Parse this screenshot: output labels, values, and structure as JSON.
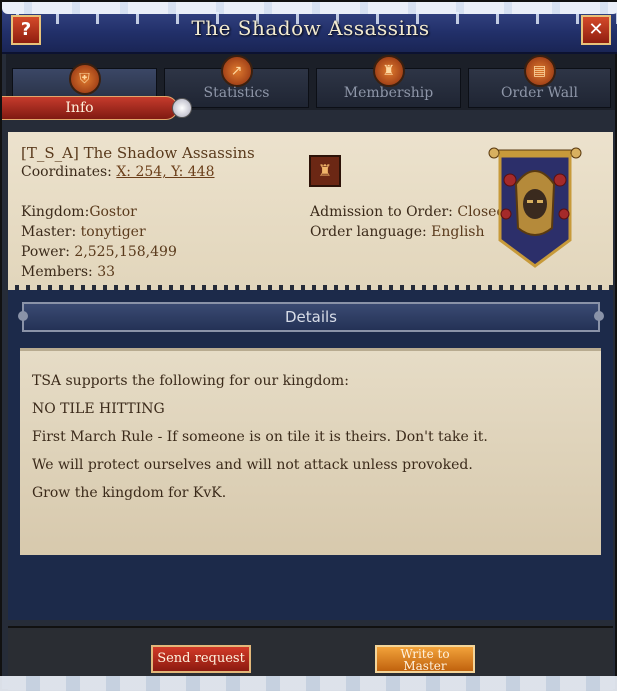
{
  "window": {
    "title": "The Shadow Assassins",
    "help_label": "?",
    "close_label": "✕"
  },
  "tabs": [
    {
      "label": "Info",
      "icon": "shield-crest-icon"
    },
    {
      "label": "Statistics",
      "icon": "chart-icon"
    },
    {
      "label": "Membership",
      "icon": "helmet-icon"
    },
    {
      "label": "Order Wall",
      "icon": "scroll-icon"
    }
  ],
  "order": {
    "name": "[T_S_A] The Shadow Assassins",
    "coordinates_label": "Coordinates:",
    "coordinates_value": "X: 254, Y: 448",
    "kingdom_label": "Kingdom:",
    "kingdom_value": "Gostor",
    "master_label": "Master:",
    "master_value": "tonytiger",
    "power_label": "Power:",
    "power_value": "2,525,158,499",
    "members_label": "Members:",
    "members_value": "33",
    "admission_label": "Admission to Order:",
    "admission_value": "Closed",
    "language_label": "Order language:",
    "language_value": "English",
    "crest_icon": "castle-tower-icon",
    "banner_icon": "hooded-assassin-banner-icon"
  },
  "details": {
    "header": "Details",
    "lines": [
      "TSA supports the following for our kingdom:",
      "NO TILE HITTING",
      "First March Rule - If someone is on tile it is theirs.  Don't take it.",
      "We will protect ourselves and will not attack unless provoked.",
      "Grow the kingdom for KvK."
    ]
  },
  "buttons": {
    "send_request": "Send request",
    "write_to_master_line1": "Write to",
    "write_to_master_line2": "Master"
  },
  "colors": {
    "title_bar": "#22306a",
    "parchment": "#e8ddc6",
    "accent_red": "#c63b2c",
    "accent_orange": "#f2a23a",
    "text_brown": "#5a3a1c"
  }
}
